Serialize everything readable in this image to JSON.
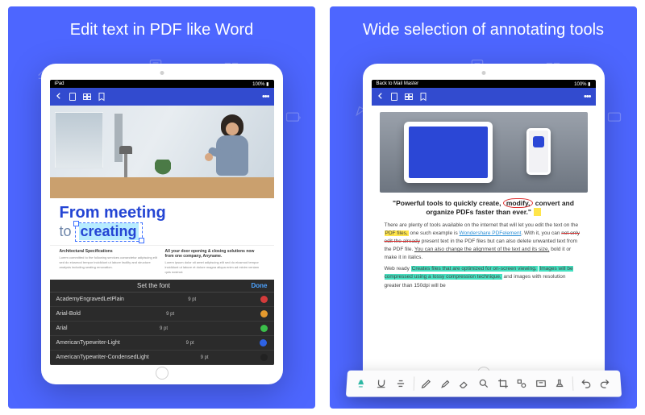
{
  "panels": {
    "left": {
      "title": "Edit text in PDF like Word"
    },
    "right": {
      "title": "Wide selection of annotating tools"
    }
  },
  "ipad": {
    "status_left": "iPad",
    "status_right_back": "Back to Mail Master"
  },
  "left_doc": {
    "headline_line1": "From meeting",
    "headline_to": "to",
    "headline_edit_word": "creating",
    "col1_heading": "Architectural Specifications",
    "col1_text": "Lorem committed to the following services consectetur adipiscing elit sed do eiusmod tempor incididunt ut labore facility and structure analysis including seating renovation.",
    "col2_heading": "All your door opening & closing solutions now from one company, Anyname.",
    "col2_text": "Lorem ipsum dolor sit amet adipiscing elit sed do eiusmod tempor incididunt ut labore et dolore magna aliqua enim ad minim veniam quis nostrud."
  },
  "font_panel": {
    "title": "Set the font",
    "done": "Done",
    "rows": [
      {
        "name": "AcademyEngravedLetPlain",
        "size": "9 pt",
        "color": "#d43b3b"
      },
      {
        "name": "Arial-Bold",
        "size": "9 pt",
        "color": "#e59a2e"
      },
      {
        "name": "Arial",
        "size": "9 pt",
        "color": "#3bbf4a"
      },
      {
        "name": "AmericanTypewriter-Light",
        "size": "9 pt",
        "color": "#2e63e5"
      },
      {
        "name": "AmericanTypewriter-CondensedLight",
        "size": "9 pt",
        "color": "#222222"
      }
    ]
  },
  "right_doc": {
    "quote_pre": "\"Powerful tools to quickly create, ",
    "quote_circled": "modify,",
    "quote_post": " convert and organize PDFs faster than ever.\"",
    "p1_a": "There are plenty of tools available on the internet that will let you edit the text on the ",
    "p1_hl": "PDF files,",
    "p1_b": " one such example is ",
    "p1_link": "Wondershare PDFelement",
    "p1_c": ". With it, you can ",
    "p1_strike": "not only edit the already",
    "p1_d": " present text in the PDF files but can also delete unwanted text from the PDF file. ",
    "p1_under": "You can also change the alignment of the text and its size,",
    "p1_e": " bold it or make it in italics.",
    "p2_a": "Web ready ",
    "p2_hl1": "Creates files that are optimized for on-screen viewing.",
    "p2_b": " ",
    "p2_hl2": "Images will be compressed using a lossy compression technique,",
    "p2_c": " and images with resolution greater than 150dpi will be"
  },
  "anno_tools": [
    "highlight",
    "text-underline",
    "text-strike",
    "pen",
    "marker",
    "eraser",
    "search",
    "crop",
    "shapes",
    "text-box",
    "stamp",
    "undo",
    "redo"
  ]
}
